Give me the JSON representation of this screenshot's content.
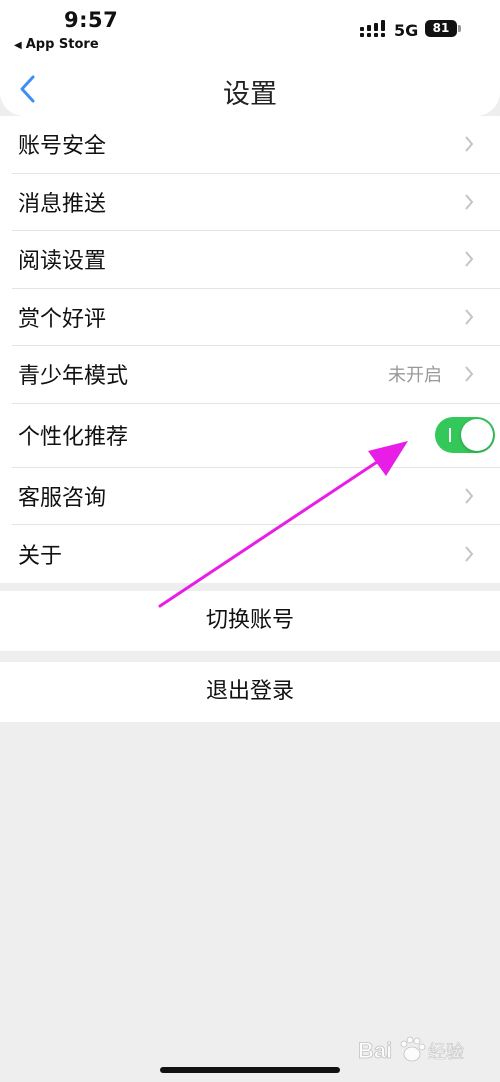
{
  "status_bar": {
    "time": "9:57",
    "back_app": "App Store",
    "network": "5G",
    "battery": "81"
  },
  "header": {
    "title": "设置",
    "back_icon": "chevron-left-icon"
  },
  "settings": {
    "items": [
      {
        "label": "账号安全"
      },
      {
        "label": "消息推送"
      },
      {
        "label": "阅读设置"
      },
      {
        "label": "赏个好评"
      },
      {
        "label": "青少年模式",
        "value": "未开启"
      },
      {
        "label": "个性化推荐",
        "toggle_on": true
      },
      {
        "label": "客服咨询"
      },
      {
        "label": "关于"
      }
    ]
  },
  "actions": {
    "switch_account": "切换账号",
    "logout": "退出登录"
  },
  "colors": {
    "accent": "#3d8ff5",
    "toggle_on": "#34c759",
    "annotation_arrow": "#e81ee6",
    "background": "#eeeeee"
  }
}
